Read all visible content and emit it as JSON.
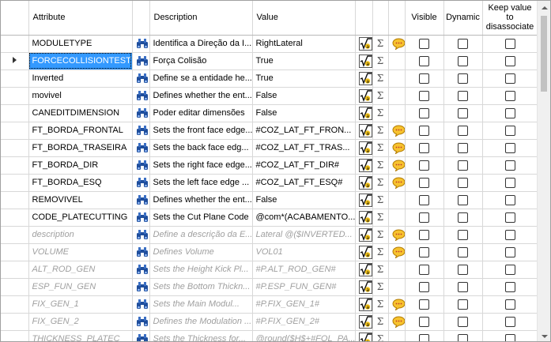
{
  "columns": {
    "attribute": "Attribute",
    "description": "Description",
    "value": "Value",
    "visible": "Visible",
    "dynamic": "Dynamic",
    "keep_value": "Keep value to disassociate"
  },
  "icons": {
    "lookup": "binoculars-icon",
    "formula": "formula-editor-icon",
    "sum": "sigma-icon",
    "comment": "comment-bubble-icon",
    "row_pointer": "current-row-pointer-icon"
  },
  "colors": {
    "selection": "#3399ff",
    "inherited_text": "#a0a0a0",
    "bubble_fill": "#f7c22e"
  },
  "rows": [
    {
      "attribute": "MODULETYPE",
      "description": "Identifica a Direção da I...",
      "value": "RightLateral",
      "comment": true,
      "inherited": false,
      "selected": false,
      "current": false
    },
    {
      "attribute": "FORCECOLLISIONTEST",
      "description": "Força Colisão",
      "value": "True",
      "comment": false,
      "inherited": false,
      "selected": true,
      "current": true
    },
    {
      "attribute": "Inverted",
      "description": "Define se a entidade he...",
      "value": "True",
      "comment": false,
      "inherited": false,
      "selected": false,
      "current": false
    },
    {
      "attribute": "movivel",
      "description": "Defines whether the ent...",
      "value": "False",
      "comment": false,
      "inherited": false,
      "selected": false,
      "current": false
    },
    {
      "attribute": "CANEDITDIMENSION",
      "description": "Poder editar dimensões",
      "value": "False",
      "comment": false,
      "inherited": false,
      "selected": false,
      "current": false
    },
    {
      "attribute": "FT_BORDA_FRONTAL",
      "description": "Sets the front face edge...",
      "value": "#COZ_LAT_FT_FRON...",
      "comment": true,
      "inherited": false,
      "selected": false,
      "current": false
    },
    {
      "attribute": "FT_BORDA_TRASEIRA",
      "description": "Sets the back face edg...",
      "value": "#COZ_LAT_FT_TRAS...",
      "comment": true,
      "inherited": false,
      "selected": false,
      "current": false
    },
    {
      "attribute": "FT_BORDA_DIR",
      "description": "Sets the right face edge...",
      "value": "#COZ_LAT_FT_DIR#",
      "comment": true,
      "inherited": false,
      "selected": false,
      "current": false
    },
    {
      "attribute": "FT_BORDA_ESQ",
      "description": "Sets the left face edge ...",
      "value": "#COZ_LAT_FT_ESQ#",
      "comment": true,
      "inherited": false,
      "selected": false,
      "current": false
    },
    {
      "attribute": "REMOVIVEL",
      "description": "Defines whether the ent...",
      "value": "False",
      "comment": false,
      "inherited": false,
      "selected": false,
      "current": false
    },
    {
      "attribute": "CODE_PLATECUTTING",
      "description": "Sets the Cut Plane Code",
      "value": "@com*(ACABAMENTO...",
      "comment": false,
      "inherited": false,
      "selected": false,
      "current": false
    },
    {
      "attribute": "description",
      "description": "Define a descrição da E...",
      "value": "Lateral @($INVERTED...",
      "comment": true,
      "inherited": true,
      "selected": false,
      "current": false
    },
    {
      "attribute": "VOLUME",
      "description": "Defines Volume",
      "value": "VOL01",
      "comment": true,
      "inherited": true,
      "selected": false,
      "current": false
    },
    {
      "attribute": "ALT_ROD_GEN",
      "description": "Sets the Height Kick Pl...",
      "value": "#P.ALT_ROD_GEN#",
      "comment": false,
      "inherited": true,
      "selected": false,
      "current": false
    },
    {
      "attribute": "ESP_FUN_GEN",
      "description": "Sets the Bottom Thickn...",
      "value": "#P.ESP_FUN_GEN#",
      "comment": false,
      "inherited": true,
      "selected": false,
      "current": false
    },
    {
      "attribute": "FIX_GEN_1",
      "description": "Sets the Main Modul...",
      "value": "#P.FIX_GEN_1#",
      "comment": true,
      "inherited": true,
      "selected": false,
      "current": false
    },
    {
      "attribute": "FIX_GEN_2",
      "description": "Defines the Modulation ...",
      "value": "#P.FIX_GEN_2#",
      "comment": true,
      "inherited": true,
      "selected": false,
      "current": false
    },
    {
      "attribute": "THICKNESS_PLATEC",
      "description": "Sets the Thickness for...",
      "value": "@round($H$+#FOL_PA...",
      "comment": false,
      "inherited": true,
      "selected": false,
      "current": false
    }
  ]
}
